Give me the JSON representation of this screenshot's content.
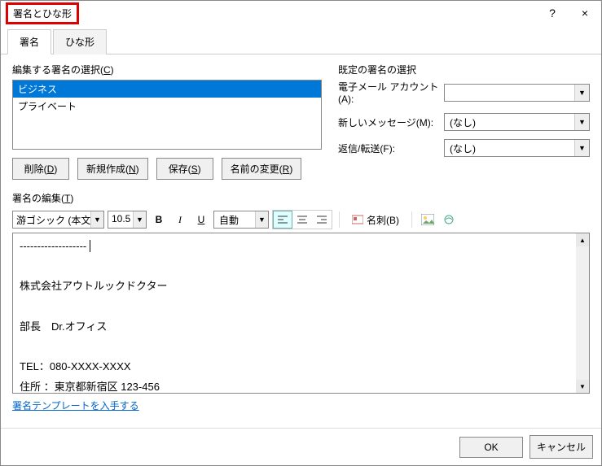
{
  "title": "署名とひな形",
  "titlebar": {
    "help": "?",
    "close": "×"
  },
  "tabs": {
    "signature": "署名",
    "stationery": "ひな形"
  },
  "selectSig": {
    "label_pre": "編集する署名の選択(",
    "label_key": "C",
    "label_post": ")",
    "items": [
      "ビジネス",
      "プライベート"
    ],
    "selectedIndex": 0
  },
  "buttons": {
    "delete_pre": "削除(",
    "delete_key": "D",
    "delete_post": ")",
    "new_pre": "新規作成(",
    "new_key": "N",
    "new_post": ")",
    "save_pre": "保存(",
    "save_key": "S",
    "save_post": ")",
    "rename_pre": "名前の変更(",
    "rename_key": "R",
    "rename_post": ")"
  },
  "defaultSig": {
    "header": "既定の署名の選択",
    "account_pre": "電子メール アカウント(",
    "account_key": "A",
    "account_post": "):",
    "account_value": "",
    "newmsg_pre": "新しいメッセージ(",
    "newmsg_key": "M",
    "newmsg_post": "):",
    "newmsg_value": "(なし)",
    "reply_pre": "返信/転送(",
    "reply_key": "F",
    "reply_post": "):",
    "reply_value": "(なし)"
  },
  "editSig": {
    "label_pre": "署名の編集(",
    "label_key": "T",
    "label_post": ")"
  },
  "toolbar": {
    "font": "游ゴシック (本文の",
    "size": "10.5",
    "bold": "B",
    "italic": "I",
    "underline": "U",
    "color": "自動",
    "namecard_pre": "名刺(",
    "namecard_key": "B",
    "namecard_post": ")"
  },
  "editor": {
    "line1": "-------------------",
    "line2": "株式会社アウトルックドクター",
    "line3": "部長　Dr.オフィス",
    "line4": "TEL：080-XXXX-XXXX",
    "line5": "住所 ：東京都新宿区 123-456"
  },
  "templateLink": "署名テンプレートを入手する",
  "footer": {
    "ok": "OK",
    "cancel": "キャンセル"
  }
}
